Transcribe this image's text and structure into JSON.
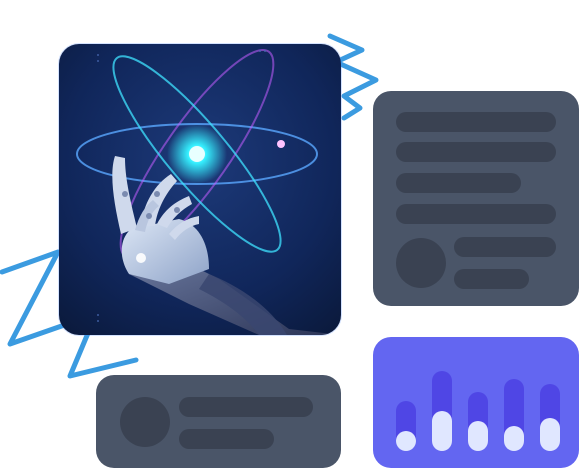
{
  "hero": {
    "image": "robotic-hand-with-atom-illustration"
  },
  "colors": {
    "card": "#4a5568",
    "skeleton": "#3a4252",
    "chart_background": "#6366f1",
    "chart_track": "#4f46e5",
    "chart_fill": "#e0e7ff",
    "squiggle": "#3b9be0",
    "hero_background": "#0f1f4a",
    "atom_core": "#35f0ff"
  },
  "chart_data": {
    "type": "bar",
    "categories": [
      "",
      "",
      "",
      "",
      ""
    ],
    "series": [
      {
        "values": [
          0.2,
          0.4,
          0.3,
          0.25,
          0.33
        ]
      }
    ],
    "tracks": [
      0.5,
      0.8,
      0.59,
      0.72,
      0.67
    ],
    "ylim": [
      0,
      1
    ],
    "title": "",
    "xlabel": "",
    "ylabel": ""
  }
}
